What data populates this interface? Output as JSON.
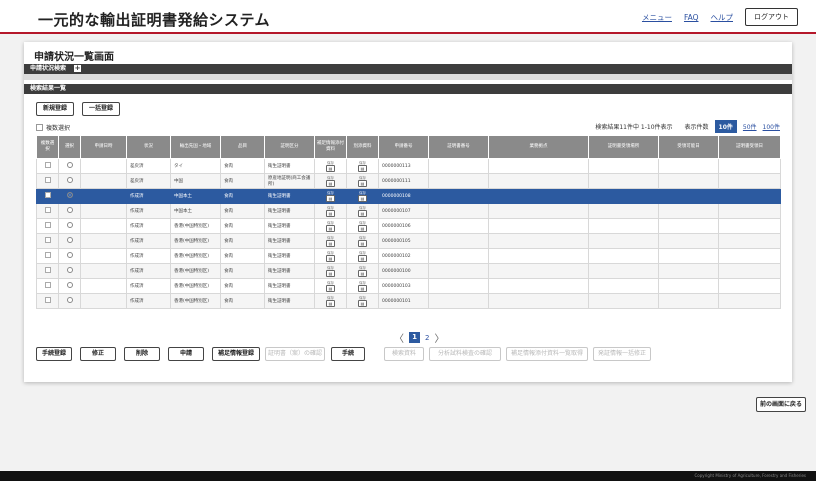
{
  "header": {
    "title": "一元的な輸出証明書発給システム",
    "nav": [
      "メニュー",
      "FAQ",
      "ヘルプ"
    ],
    "logout_label": "ログアウト"
  },
  "page": {
    "title": "申請状況一覧画面",
    "search_band": "申請状況検索",
    "search_toggle": "+",
    "results_band": "検索結果一覧",
    "new_button": "新規登録",
    "bulk_button": "一括登録",
    "multi_select": "複数選択"
  },
  "summary": {
    "text": "検索結果11件中 1-10件表示",
    "per_page_label": "表示件数",
    "options": [
      "10件",
      "50件",
      "100件"
    ],
    "active": "10件"
  },
  "table": {
    "headers": [
      "複数選択",
      "選択",
      "申請日時",
      "状況",
      "輸出先国・地域",
      "品目",
      "証明区分",
      "補足情報添付資料",
      "別添資料",
      "申請番号",
      "証明書番号",
      "業務拠点",
      "証明書受領場所",
      "受領可能日",
      "証明書受領日"
    ],
    "rows": [
      {
        "status": "差戻済",
        "country": "タイ",
        "item": "食肉",
        "cert": "衛生証明書",
        "f1": "保存",
        "f2": "保存",
        "no": "0000000113"
      },
      {
        "status": "差戻済",
        "country": "中国",
        "item": "食肉",
        "cert": "原産地証明(商工会議所)",
        "f1": "保存",
        "f2": "保存",
        "no": "0000000111"
      },
      {
        "status": "作成済",
        "country": "中国本土",
        "item": "食肉",
        "cert": "衛生証明書",
        "f1": "保存",
        "f2": "保存",
        "no": "0000000108"
      },
      {
        "status": "作成済",
        "country": "中国本土",
        "item": "食肉",
        "cert": "衛生証明書",
        "f1": "保存",
        "f2": "保存",
        "no": "0000000107"
      },
      {
        "status": "作成済",
        "country": "香港(中国特別区)",
        "item": "食肉",
        "cert": "衛生証明書",
        "f1": "保存",
        "f2": "保存",
        "no": "0000000106"
      },
      {
        "status": "作成済",
        "country": "香港(中国特別区)",
        "item": "食肉",
        "cert": "衛生証明書",
        "f1": "保存",
        "f2": "保存",
        "no": "0000000105"
      },
      {
        "status": "作成済",
        "country": "香港(中国特別区)",
        "item": "食肉",
        "cert": "衛生証明書",
        "f1": "保存",
        "f2": "保存",
        "no": "0000000102"
      },
      {
        "status": "作成済",
        "country": "香港(中国特別区)",
        "item": "食肉",
        "cert": "衛生証明書",
        "f1": "保存",
        "f2": "保存",
        "no": "0000000100"
      },
      {
        "status": "作成済",
        "country": "香港(中国特別区)",
        "item": "食肉",
        "cert": "衛生証明書",
        "f1": "保存",
        "f2": "保存",
        "no": "0000000103"
      },
      {
        "status": "作成済",
        "country": "香港(中国特別区)",
        "item": "食肉",
        "cert": "衛生証明書",
        "f1": "保存",
        "f2": "保存",
        "no": "0000000101"
      }
    ],
    "selected_row": 2
  },
  "pager": {
    "prev": "〈",
    "current": "1",
    "next_page": "2",
    "next": "〉"
  },
  "actions": {
    "b1": "手続登録",
    "b2": "修正",
    "b3": "削除",
    "b4": "申請",
    "b5": "補足情報登録",
    "b6": "証明書（案）の確認",
    "b7": "手続",
    "b8": "検索資料",
    "b9": "分析試料検査の確認",
    "b10": "補足情報添付資料一覧取得",
    "b11": "発証情報一括修正"
  },
  "back_label": "前の画面に戻る",
  "footer": "Copyright Ministry of Agriculture, Forestry and Fisheries"
}
